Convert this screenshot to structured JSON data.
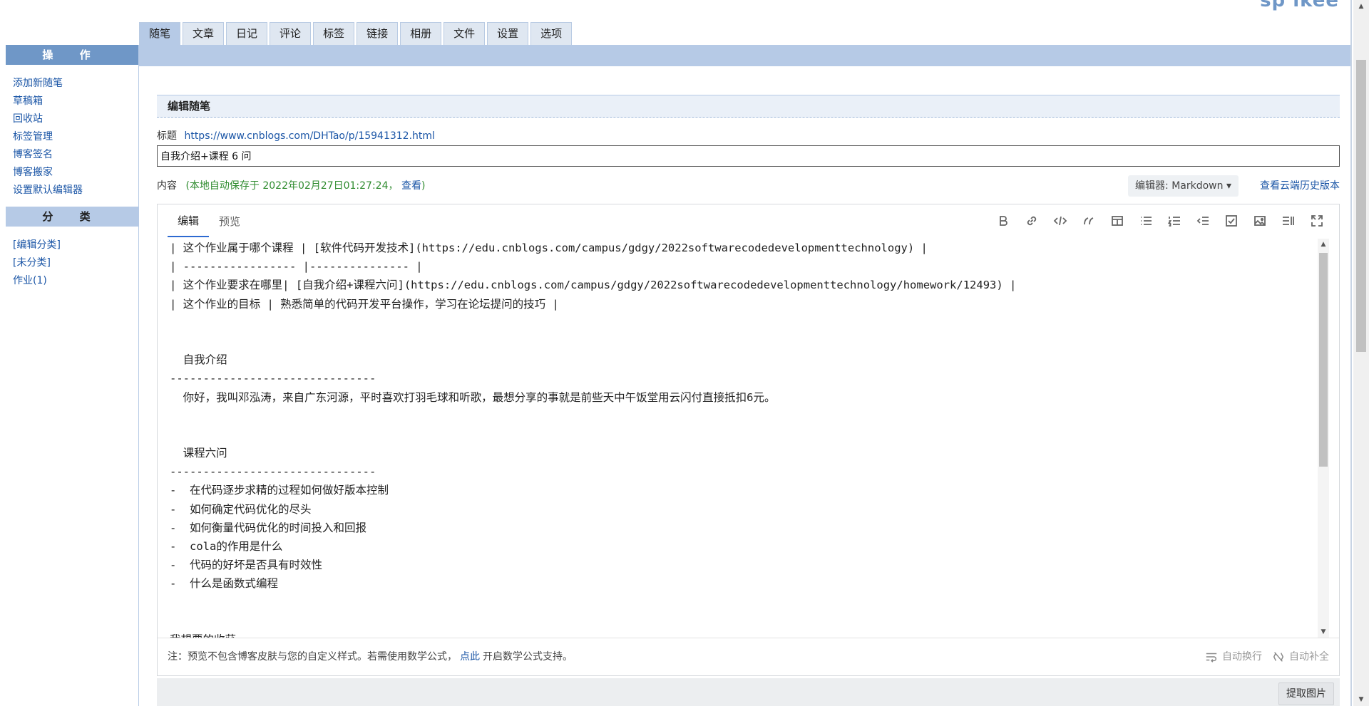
{
  "brand": "sp ikee",
  "tabs": [
    "随笔",
    "文章",
    "日记",
    "评论",
    "标签",
    "链接",
    "相册",
    "文件",
    "设置",
    "选项"
  ],
  "sidebar": {
    "ops_title": "操 作",
    "ops_items": [
      "添加新随笔",
      "草稿箱",
      "回收站",
      "标签管理",
      "博客签名",
      "博客搬家",
      "设置默认编辑器"
    ],
    "cat_title": "分 类",
    "cat_items": [
      "[编辑分类]",
      "[未分类]",
      "作业(1)"
    ]
  },
  "main": {
    "section_title": "编辑随笔",
    "title_label": "标题",
    "title_url": "https://www.cnblogs.com/DHTao/p/15941312.html",
    "title_value": "自我介绍+课程 6 问",
    "content_label": "内容",
    "autosave_text": "(本地自动保存于 2022年02月27日01:27:24，",
    "autosave_link": "查看",
    "autosave_end": ")",
    "editor_select": "编辑器: Markdown",
    "history_link": "查看云端历史版本"
  },
  "editor": {
    "tabs": [
      "编辑",
      "预览"
    ],
    "toolbar_icons": [
      "bold-icon",
      "link-icon",
      "code-icon",
      "quote-icon",
      "table-icon",
      "bullet-list-icon",
      "numbered-list-icon",
      "outdent-icon",
      "checkbox-icon",
      "image-icon",
      "split-view-icon",
      "fullscreen-icon"
    ],
    "lines": [
      "| 这个作业属于哪个课程 | [软件代码开发技术](https://edu.cnblogs.com/campus/gdgy/2022softwarecodedevelopmenttechnology) |",
      "| ----------------- |--------------- |",
      "| 这个作业要求在哪里| [自我介绍+课程六问](https://edu.cnblogs.com/campus/gdgy/2022softwarecodedevelopmenttechnology/homework/12493) |",
      "| 这个作业的目标 | 熟悉简单的代码开发平台操作，学习在论坛提问的技巧 |",
      "",
      "",
      "  自我介绍",
      "-------------------------------",
      "  你好，我叫邓泓涛，来自广东河源，平时喜欢打羽毛球和听歌，最想分享的事就是前些天中午饭堂用云闪付直接抵扣6元。",
      "",
      "",
      "  课程六问",
      "-------------------------------",
      "-  在代码逐步求精的过程如何做好版本控制",
      "-  如何确定代码优化的尽头",
      "-  如何衡量代码优化的时间投入和回报",
      "-  cola的作用是什么",
      "-  代码的好坏是否具有时效性",
      "-  什么是函数式编程",
      "",
      "",
      "我想要的收获"
    ],
    "footer_note_a": "注：预览不包含博客皮肤与您的自定义样式。若需使用数学公式，",
    "footer_link": "点此",
    "footer_note_b": "开启数学公式支持。",
    "opt_wrap": "自动换行",
    "opt_complete": "自动补全"
  },
  "extract_button": "提取图片"
}
